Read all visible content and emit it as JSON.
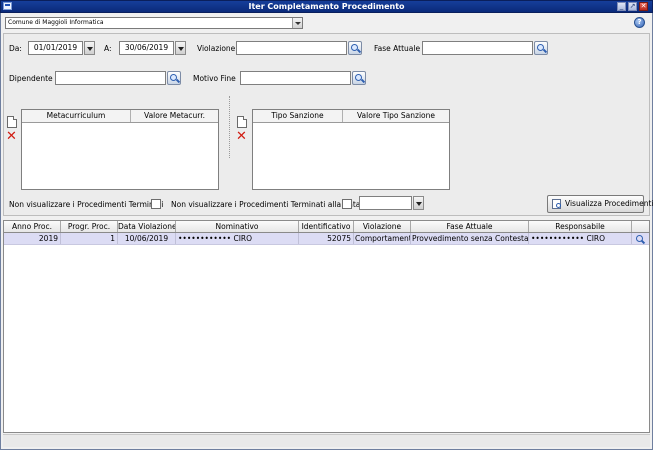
{
  "window": {
    "title": "Iter Completamento Procedimento",
    "minimize": "_",
    "maximize": "↗",
    "close": "✕"
  },
  "company_select": {
    "value": "Comune di Maggioli Informatica"
  },
  "help": {
    "glyph": "?"
  },
  "filters": {
    "da_label": "Da:",
    "da_value": "01/01/2019",
    "a_label": "A:",
    "a_value": "30/06/2019",
    "violazione_label": "Violazione",
    "violazione_value": "",
    "fase_label": "Fase Attuale",
    "fase_value": "",
    "dipendente_label": "Dipendente",
    "dipendente_value": "",
    "motivo_label": "Motivo Fine",
    "motivo_value": ""
  },
  "meta_table": {
    "columns": [
      "Metacurriculum",
      "Valore Metacurr."
    ]
  },
  "sanzione_table": {
    "columns": [
      "Tipo Sanzione",
      "Valore Tipo Sanzione"
    ]
  },
  "options": {
    "no_terminati_label": "Non visualizzare i Procedimenti Terminati",
    "no_terminati_data_label": "Non visualizzare i Procedimenti Terminati alla data",
    "date_value": ""
  },
  "visualizza_button": "Visualizza Procedimenti",
  "grid": {
    "columns": [
      "Anno Proc.",
      "Progr. Proc.",
      "Data Violazione",
      "Nominativo",
      "Identificativo",
      "Violazione",
      "Fase Attuale",
      "Responsabile"
    ],
    "rows": [
      {
        "anno": "2019",
        "progr": "1",
        "data": "10/06/2019",
        "nominativo": "•••••••••••• CIRO",
        "identificativo": "52075",
        "violazione": "Comportamenti n",
        "fase": "Provvedimento senza Contestazione",
        "responsabile": "•••••••••••• CIRO"
      }
    ]
  },
  "icons": {
    "app": "app-icon",
    "search": "search-icon",
    "calendar_dropdown": "chevron-down-icon",
    "new_document": "document-icon",
    "delete": "delete-x-icon",
    "help": "help-icon"
  },
  "colors": {
    "titlebar": "#163e9a",
    "selected_row": "#dcdcf4",
    "delete_icon": "#d01a10"
  }
}
